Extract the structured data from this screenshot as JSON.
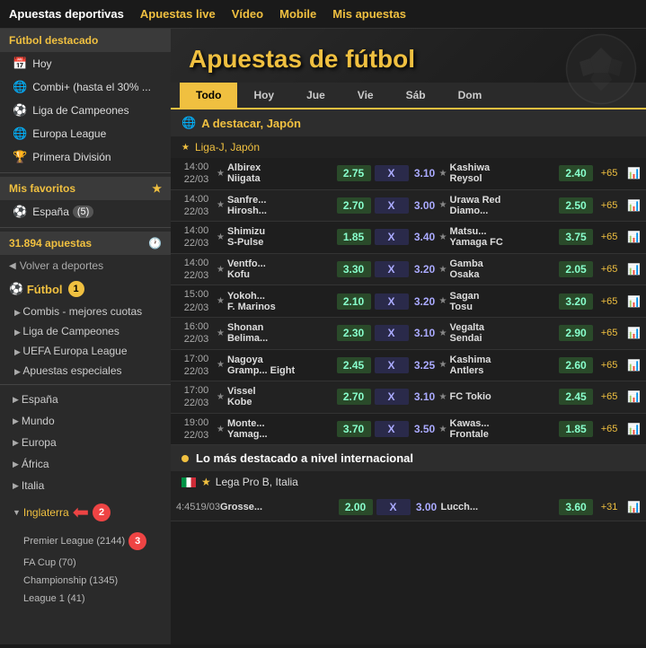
{
  "nav": {
    "items": [
      {
        "label": "Apuestas deportivas",
        "active": false
      },
      {
        "label": "Apuestas live",
        "active": false
      },
      {
        "label": "Vídeo",
        "active": false
      },
      {
        "label": "Mobile",
        "active": false
      },
      {
        "label": "Mis apuestas",
        "active": false
      }
    ]
  },
  "sidebar": {
    "featured_title": "Fútbol destacado",
    "items": [
      {
        "label": "Hoy",
        "icon": "📅"
      },
      {
        "label": "Combi+ (hasta el 30% ...",
        "icon": "🌐"
      },
      {
        "label": "Liga de Campeones",
        "icon": "⚽"
      },
      {
        "label": "Europa League",
        "icon": "🌐"
      },
      {
        "label": "Primera División",
        "icon": "🏆"
      }
    ],
    "favorites_title": "Mis favoritos",
    "favorite_item": {
      "label": "España",
      "count": "(5)"
    },
    "bets_label": "31.894 apuestas",
    "back_label": "Volver a deportes",
    "sport_label": "Fútbol",
    "sport_num": "1",
    "sub_items": [
      {
        "label": "Combis - mejores cuotas"
      },
      {
        "label": "Liga de Campeones"
      },
      {
        "label": "UEFA Europa League"
      },
      {
        "label": "Apuestas especiales"
      }
    ],
    "regions": [
      {
        "label": "España",
        "expanded": false
      },
      {
        "label": "Mundo",
        "expanded": false
      },
      {
        "label": "Europa",
        "expanded": false
      },
      {
        "label": "África",
        "expanded": false
      },
      {
        "label": "Italia",
        "expanded": false
      },
      {
        "label": "Inglaterra",
        "expanded": true
      }
    ],
    "leagues": [
      {
        "label": "Premier League (2144)"
      },
      {
        "label": "FA Cup (70)"
      },
      {
        "label": "Championship (1345)"
      },
      {
        "label": "League 1 (41)"
      }
    ],
    "annotation_2": "2",
    "annotation_3": "3"
  },
  "main": {
    "title": "Apuestas de fútbol",
    "tabs": [
      {
        "label": "Todo",
        "active": true
      },
      {
        "label": "Hoy",
        "active": false
      },
      {
        "label": "Jue",
        "active": false
      },
      {
        "label": "Vie",
        "active": false
      },
      {
        "label": "Sáb",
        "active": false
      },
      {
        "label": "Dom",
        "active": false
      }
    ],
    "section_title": "A destacar, Japón",
    "league_title": "Liga-J, Japón",
    "matches": [
      {
        "time": "14:00",
        "date": "22/03",
        "home": "Albirex Niigata",
        "away": "Kashiwa Reysol",
        "odd1": "2.75",
        "oddX": "3.10",
        "odd2": "2.40",
        "more": "+65"
      },
      {
        "time": "14:00",
        "date": "22/03",
        "home": "Sanfre... Hirosh...",
        "away": "Urawa Red Diamo...",
        "odd1": "2.70",
        "oddX": "3.00",
        "odd2": "2.50",
        "more": "+65"
      },
      {
        "time": "14:00",
        "date": "22/03",
        "home": "Shimizu S-Pulse",
        "away": "Matsu... Yamaga FC",
        "odd1": "1.85",
        "oddX": "3.40",
        "odd2": "3.75",
        "more": "+65"
      },
      {
        "time": "14:00",
        "date": "22/03",
        "home": "Ventfo... Kofu",
        "away": "Gamba Osaka",
        "odd1": "3.30",
        "oddX": "3.20",
        "odd2": "2.05",
        "more": "+65"
      },
      {
        "time": "15:00",
        "date": "22/03",
        "home": "Yokoh... F. Marinos",
        "away": "Sagan Tosu",
        "odd1": "2.10",
        "oddX": "3.20",
        "odd2": "3.20",
        "more": "+65"
      },
      {
        "time": "16:00",
        "date": "22/03",
        "home": "Shonan Belima...",
        "away": "Vegalta Sendai",
        "odd1": "2.30",
        "oddX": "3.10",
        "odd2": "2.90",
        "more": "+65"
      },
      {
        "time": "17:00",
        "date": "22/03",
        "home": "Nagoya Gramp... Eight",
        "away": "Kashima Antlers",
        "odd1": "2.45",
        "oddX": "3.25",
        "odd2": "2.60",
        "more": "+65"
      },
      {
        "time": "17:00",
        "date": "22/03",
        "home": "Vissel Kobe",
        "away": "FC Tokio",
        "odd1": "2.70",
        "oddX": "3.10",
        "odd2": "2.45",
        "more": "+65"
      },
      {
        "time": "19:00",
        "date": "22/03",
        "home": "Monte... Yamag...",
        "away": "Kawas... Frontale",
        "odd1": "3.70",
        "oddX": "3.50",
        "odd2": "1.85",
        "more": "+65"
      }
    ],
    "intl_title": "Lo más destacado a nivel internacional",
    "italy_league": "Lega Pro B, Italia",
    "italy_match": {
      "time": "4:4519/03",
      "home": "Grosse...",
      "away": "Lucch...",
      "odd1": "2.00",
      "oddX": "3.00",
      "odd2": "3.60",
      "more": "+31"
    }
  }
}
